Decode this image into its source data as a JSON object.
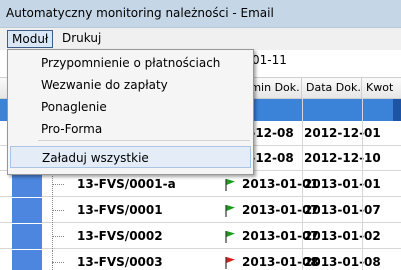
{
  "window": {
    "title": "Automatyczny monitoring należności - Email"
  },
  "menubar": {
    "items": [
      "Moduł",
      "Drukuj"
    ]
  },
  "dropdown": {
    "items": [
      "Przypomnienie o płatnościach",
      "Wezwanie do zapłaty",
      "Ponaglenie",
      "Pro-Forma"
    ],
    "extra": "Załaduj wszystkie"
  },
  "filter": {
    "date_fragment": "01-11"
  },
  "grid": {
    "headers": [
      "rmin Dok.",
      "Data Dok.",
      "Kwot"
    ],
    "rows": [
      {
        "doc": "",
        "flag": "",
        "date1": "2-12-08",
        "date2": "2012-12-01"
      },
      {
        "doc": "",
        "flag": "",
        "date1": "2-12-08",
        "date2": "2012-12-10"
      },
      {
        "doc": "13-FVS/0001-a",
        "flag": "green",
        "date1": "2013-01-01",
        "date2": "2013-01-01"
      },
      {
        "doc": "13-FVS/0001",
        "flag": "green",
        "date1": "2013-01-07",
        "date2": "2013-01-07"
      },
      {
        "doc": "13-FVS/0002",
        "flag": "green",
        "date1": "2013-01-07",
        "date2": "2013-01-02"
      },
      {
        "doc": "13-FVS/0003",
        "flag": "red",
        "date1": "2013-01-08",
        "date2": "2013-01-08"
      }
    ]
  },
  "colors": {
    "green_flag": "#1c9a1c",
    "red_flag": "#d42020",
    "selection": "#3b83d9"
  }
}
